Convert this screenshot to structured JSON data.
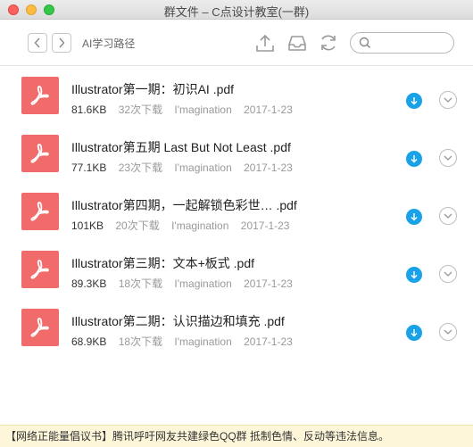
{
  "window": {
    "title": "群文件 – C点设计教室(一群)"
  },
  "toolbar": {
    "breadcrumb": "AI学习路径",
    "search_placeholder": ""
  },
  "files": [
    {
      "name": "Illustrator第一期：初识AI .pdf",
      "size": "81.6KB",
      "downloads": "32次下载",
      "uploader": "I'magination",
      "date": "2017-1-23"
    },
    {
      "name": "Illustrator第五期 Last But Not Least .pdf",
      "size": "77.1KB",
      "downloads": "23次下载",
      "uploader": "I'magination",
      "date": "2017-1-23"
    },
    {
      "name": "Illustrator第四期，一起解锁色彩世…    .pdf",
      "size": "101KB",
      "downloads": "20次下载",
      "uploader": "I'magination",
      "date": "2017-1-23"
    },
    {
      "name": "Illustrator第三期：文本+板式 .pdf",
      "size": "89.3KB",
      "downloads": "18次下载",
      "uploader": "I'magination",
      "date": "2017-1-23"
    },
    {
      "name": "Illustrator第二期：认识描边和填充 .pdf",
      "size": "68.9KB",
      "downloads": "18次下载",
      "uploader": "I'magination",
      "date": "2017-1-23"
    }
  ],
  "notice": "【网络正能量倡议书】腾讯呼吁网友共建绿色QQ群 抵制色情、反动等违法信息。",
  "colors": {
    "pdf_icon": "#f16b6b",
    "download_button": "#1aa2e8",
    "notice_bg": "#fdf6d9"
  }
}
